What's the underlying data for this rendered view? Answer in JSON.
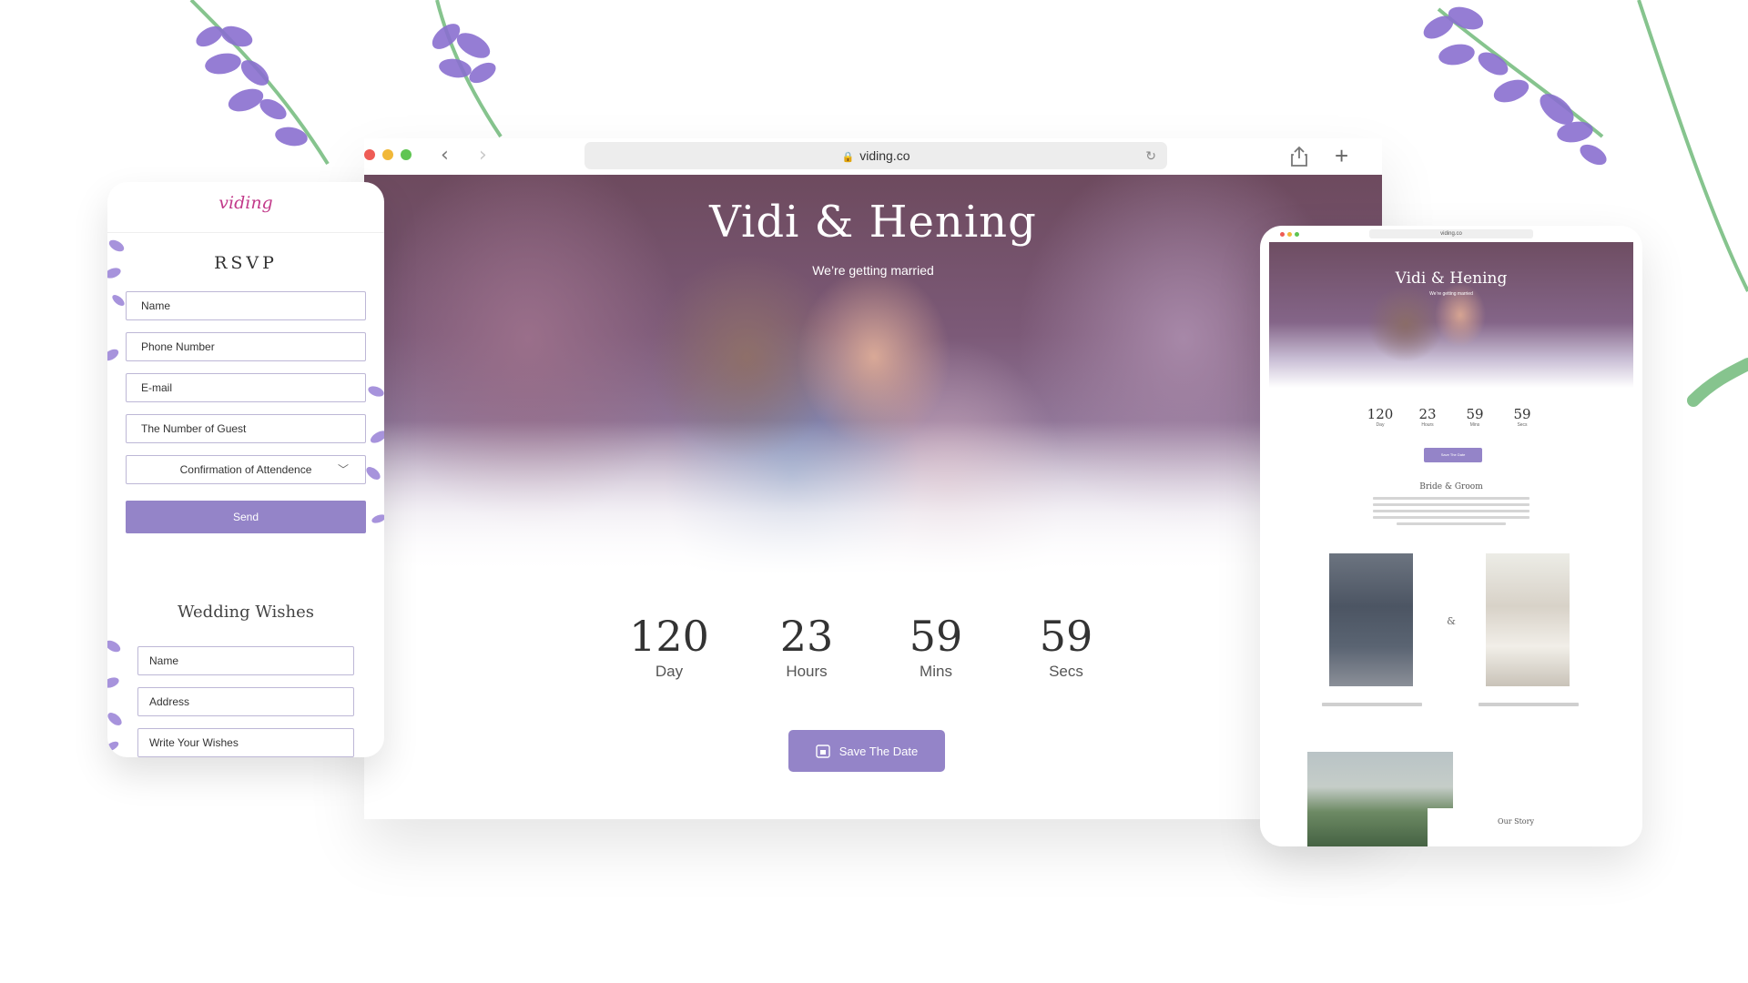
{
  "browser": {
    "url": "viding.co",
    "hero": {
      "title": "Vidi & Hening",
      "subtitle": "We’re getting married"
    },
    "countdown": [
      {
        "value": "120",
        "label": "Day"
      },
      {
        "value": "23",
        "label": "Hours"
      },
      {
        "value": "59",
        "label": "Mins"
      },
      {
        "value": "59",
        "label": "Secs"
      }
    ],
    "save_button": "Save The Date"
  },
  "mobile": {
    "logo": "viding",
    "rsvp_title": "RSVP",
    "rsvp_fields": [
      "Name",
      "Phone Number",
      "E-mail",
      "The Number of Guest"
    ],
    "attendance_select": "Confirmation of Attendence",
    "send_button": "Send",
    "wishes_title": "Wedding Wishes",
    "wishes_fields": [
      "Name",
      "Address",
      "Write Your Wishes"
    ]
  },
  "tablet": {
    "url": "viding.co",
    "title": "Vidi & Hening",
    "subtitle": "We’re getting married",
    "countdown": [
      {
        "value": "120",
        "label": "Day"
      },
      {
        "value": "23",
        "label": "Hours"
      },
      {
        "value": "59",
        "label": "Mins"
      },
      {
        "value": "59",
        "label": "Secs"
      }
    ],
    "save_button": "Save The Date",
    "section_title": "Bride & Groom",
    "ampersand": "&",
    "story_title": "Our Story"
  },
  "colors": {
    "accent": "#9484c8",
    "logo": "#c23a8a",
    "lavender": "#8a6fd0",
    "stem": "#86c48e"
  }
}
